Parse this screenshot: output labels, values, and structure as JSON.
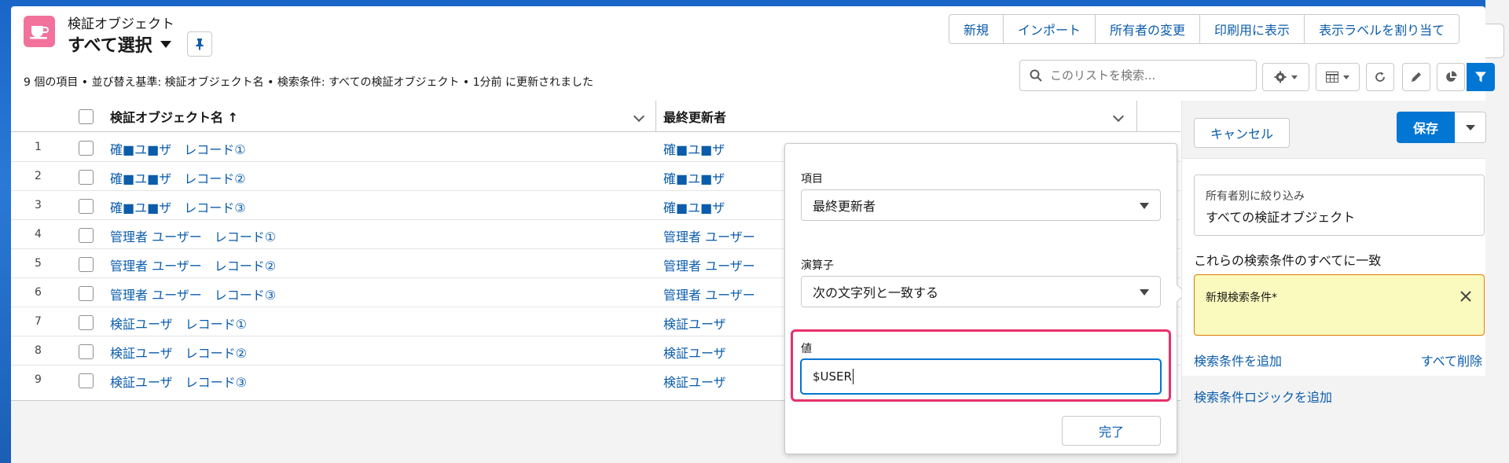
{
  "header": {
    "object_type": "検証オブジェクト",
    "list_view": "すべて選択"
  },
  "actions": [
    "新規",
    "インポート",
    "所有者の変更",
    "印刷用に表示",
    "表示ラベルを割り当て"
  ],
  "subtitle": "9 個の項目 • 並び替え基準: 検証オブジェクト名 • 検索条件: すべての検証オブジェクト • 1分前 に更新されました",
  "search": {
    "placeholder": "このリストを検索..."
  },
  "table": {
    "columns": {
      "name": "検証オブジェクト名 ↑",
      "modified_by": "最終更新者"
    },
    "rows": [
      {
        "num": "1",
        "name": "確■ユ■ザ　レコード①",
        "modified_by": "確■ユ■ザ"
      },
      {
        "num": "2",
        "name": "確■ユ■ザ　レコード②",
        "modified_by": "確■ユ■ザ"
      },
      {
        "num": "3",
        "name": "確■ユ■ザ　レコード③",
        "modified_by": "確■ユ■ザ"
      },
      {
        "num": "4",
        "name": "管理者 ユーザー　レコード①",
        "modified_by": "管理者 ユーザー"
      },
      {
        "num": "5",
        "name": "管理者 ユーザー　レコード②",
        "modified_by": "管理者 ユーザー"
      },
      {
        "num": "6",
        "name": "管理者 ユーザー　レコード③",
        "modified_by": "管理者 ユーザー"
      },
      {
        "num": "7",
        "name": "検証ユーザ　レコード①",
        "modified_by": "検証ユーザ"
      },
      {
        "num": "8",
        "name": "検証ユーザ　レコード②",
        "modified_by": "検証ユーザ"
      },
      {
        "num": "9",
        "name": "検証ユーザ　レコード③",
        "modified_by": "検証ユーザ"
      }
    ]
  },
  "popover": {
    "field_label": "項目",
    "field_value": "最終更新者",
    "operator_label": "演算子",
    "operator_value": "次の文字列と一致する",
    "value_label": "値",
    "value_text": "$USER",
    "done_label": "完了"
  },
  "filter_panel": {
    "cancel_label": "キャンセル",
    "save_label": "保存",
    "owner_label": "所有者別に絞り込み",
    "owner_value": "すべての検証オブジェクト",
    "match_label": "これらの検索条件のすべてに一致",
    "new_filter_label": "新規検索条件*",
    "add_filter_label": "検索条件を追加",
    "remove_all_label": "すべて削除",
    "add_logic_label": "検索条件ロジックを追加"
  },
  "colors": {
    "brand": "#0176d3",
    "link": "#0b5cab",
    "object_icon": "#f2729b",
    "highlight": "#e8306a",
    "new_filter_bg": "#fafabe"
  }
}
